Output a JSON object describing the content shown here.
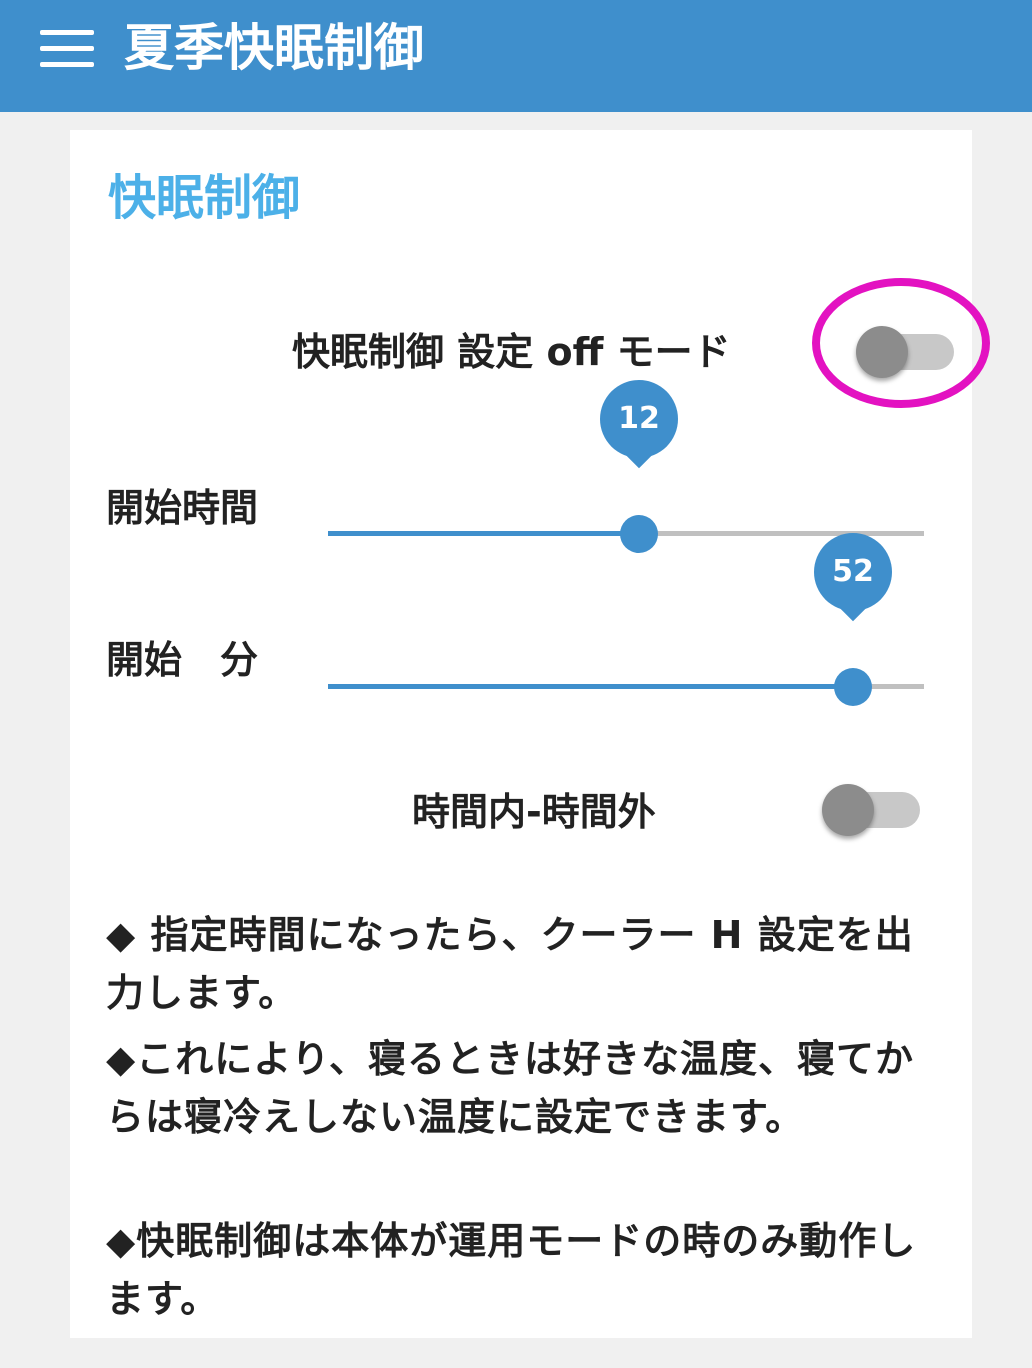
{
  "header": {
    "title": "夏季快眠制御",
    "menu_icon": "hamburger-menu-icon",
    "background_color": "#3f8fcc"
  },
  "card": {
    "title": "快眠制御",
    "title_color": "#4cb0e8",
    "sleep_mode_switch": {
      "label": "快眠制御 設定 off モード",
      "checked": false
    },
    "start_hour": {
      "label": "開始時間",
      "value": 12,
      "min": 0,
      "max": 23,
      "value_text": "12"
    },
    "start_minute": {
      "label": "開始　分",
      "value": 52,
      "min": 0,
      "max": 59,
      "value_text": "52"
    },
    "range_switch": {
      "label": "時間内-時間外",
      "checked": false
    },
    "descriptions": [
      "◆ 指定時間になったら、クーラー H 設定を出力します。",
      "◆これにより、寝るときは好きな温度、寝てからは寝冷えしない温度に設定できます。",
      "◆快眠制御は本体が運用モードの時のみ動作します。"
    ]
  },
  "annotation": {
    "highlight_color": "#e312c1"
  }
}
